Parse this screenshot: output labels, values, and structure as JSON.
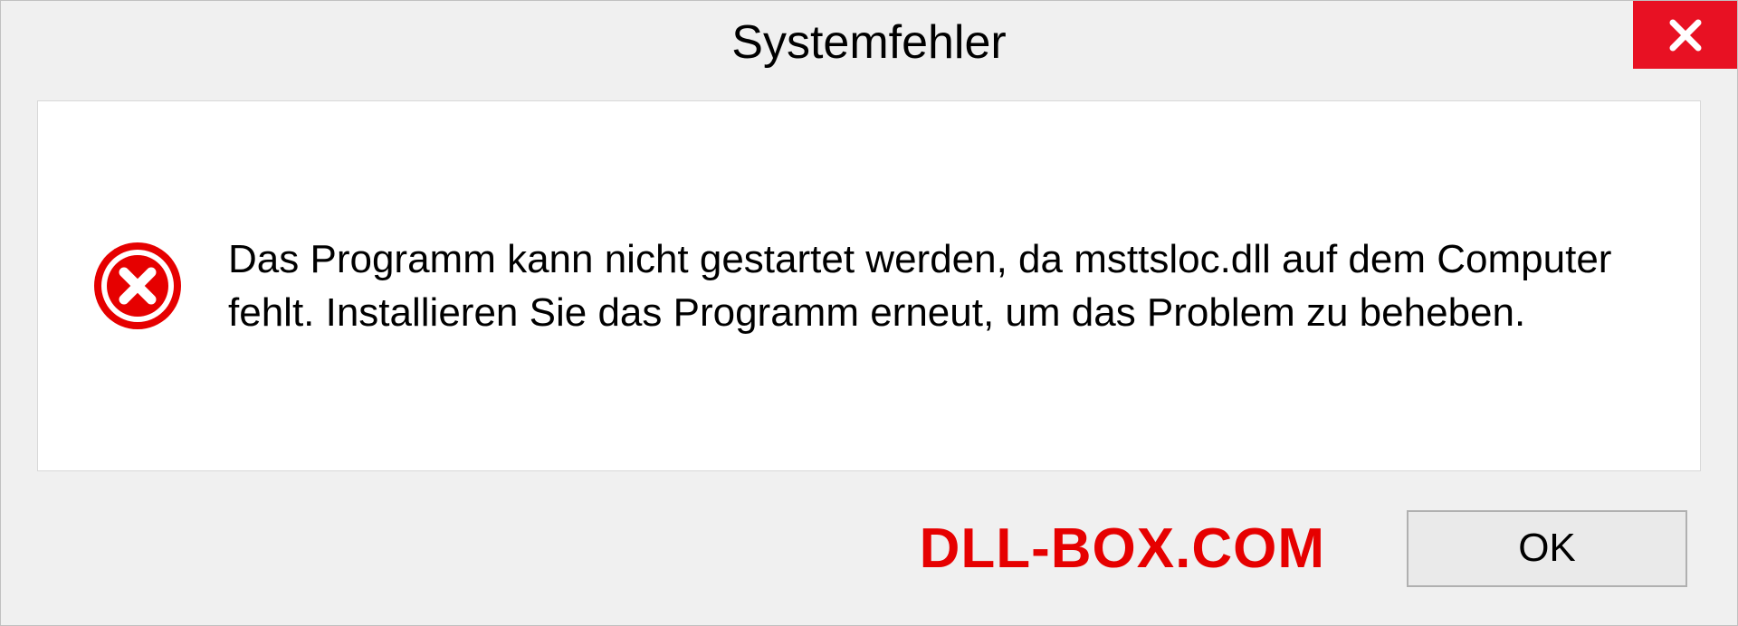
{
  "dialog": {
    "title": "Systemfehler",
    "message": "Das Programm kann nicht gestartet werden, da msttsloc.dll auf dem Computer fehlt. Installieren Sie das Programm erneut, um das Problem zu beheben.",
    "ok_label": "OK",
    "watermark": "DLL-BOX.COM"
  }
}
